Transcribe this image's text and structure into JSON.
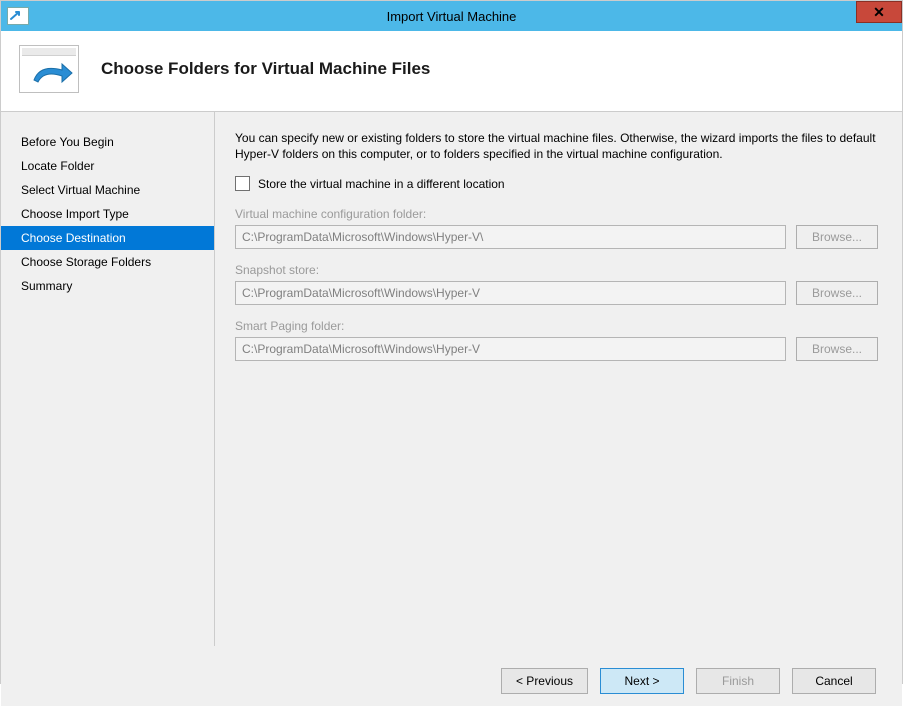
{
  "window": {
    "title": "Import Virtual Machine"
  },
  "header": {
    "title": "Choose Folders for Virtual Machine Files"
  },
  "sidebar": {
    "steps": [
      "Before You Begin",
      "Locate Folder",
      "Select Virtual Machine",
      "Choose Import Type",
      "Choose Destination",
      "Choose Storage Folders",
      "Summary"
    ],
    "active_index": 4
  },
  "content": {
    "intro": "You can specify new or existing folders to store the virtual machine files. Otherwise, the wizard imports the files to default Hyper-V folders on this computer, or to folders specified in the virtual machine configuration.",
    "checkbox_label": "Store the virtual machine in a different location",
    "checkbox_checked": false,
    "fields": [
      {
        "label": "Virtual machine configuration folder:",
        "value": "C:\\ProgramData\\Microsoft\\Windows\\Hyper-V\\",
        "browse": "Browse..."
      },
      {
        "label": "Snapshot store:",
        "value": "C:\\ProgramData\\Microsoft\\Windows\\Hyper-V",
        "browse": "Browse..."
      },
      {
        "label": "Smart Paging folder:",
        "value": "C:\\ProgramData\\Microsoft\\Windows\\Hyper-V",
        "browse": "Browse..."
      }
    ]
  },
  "footer": {
    "previous": "< Previous",
    "next": "Next >",
    "finish": "Finish",
    "cancel": "Cancel"
  }
}
